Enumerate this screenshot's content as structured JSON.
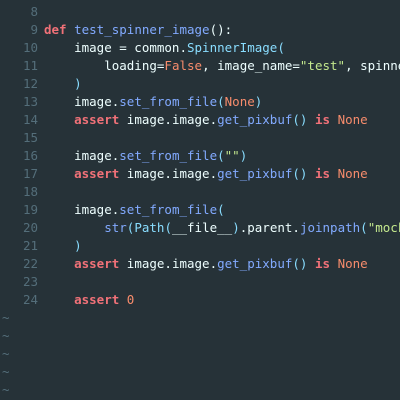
{
  "editor": {
    "colors": {
      "background": "#263238",
      "gutter": "#546e7a",
      "keyword": "#f07178",
      "function": "#82aaff",
      "class": "#89ddff",
      "constant": "#f78c6c",
      "string": "#c3e88d",
      "text": "#eeffff"
    },
    "lines": [
      {
        "num": "8",
        "tokens": []
      },
      {
        "num": "9",
        "tokens": [
          {
            "t": "kw",
            "v": "def"
          },
          {
            "t": "plain",
            "v": " "
          },
          {
            "t": "fn",
            "v": "test_spinner_image"
          },
          {
            "t": "plain",
            "v": "():"
          }
        ]
      },
      {
        "num": "10",
        "tokens": [
          {
            "t": "plain",
            "v": "    image = common."
          },
          {
            "t": "cls",
            "v": "SpinnerImage"
          },
          {
            "t": "punc",
            "v": "("
          }
        ]
      },
      {
        "num": "11",
        "tokens": [
          {
            "t": "plain",
            "v": "        loading="
          },
          {
            "t": "const",
            "v": "False"
          },
          {
            "t": "plain",
            "v": ", image_name="
          },
          {
            "t": "str",
            "v": "\"test\""
          },
          {
            "t": "plain",
            "v": ", spinner_n"
          }
        ]
      },
      {
        "num": "12",
        "tokens": [
          {
            "t": "plain",
            "v": "    "
          },
          {
            "t": "punc",
            "v": ")"
          }
        ]
      },
      {
        "num": "13",
        "tokens": [
          {
            "t": "plain",
            "v": "    image."
          },
          {
            "t": "fn",
            "v": "set_from_file"
          },
          {
            "t": "punc",
            "v": "("
          },
          {
            "t": "const",
            "v": "None"
          },
          {
            "t": "punc",
            "v": ")"
          }
        ]
      },
      {
        "num": "14",
        "tokens": [
          {
            "t": "plain",
            "v": "    "
          },
          {
            "t": "kw",
            "v": "assert"
          },
          {
            "t": "plain",
            "v": " image.image."
          },
          {
            "t": "fn",
            "v": "get_pixbuf"
          },
          {
            "t": "punc",
            "v": "()"
          },
          {
            "t": "plain",
            "v": " "
          },
          {
            "t": "kw",
            "v": "is"
          },
          {
            "t": "plain",
            "v": " "
          },
          {
            "t": "const",
            "v": "None"
          }
        ]
      },
      {
        "num": "15",
        "tokens": []
      },
      {
        "num": "16",
        "tokens": [
          {
            "t": "plain",
            "v": "    image."
          },
          {
            "t": "fn",
            "v": "set_from_file"
          },
          {
            "t": "punc",
            "v": "("
          },
          {
            "t": "str",
            "v": "\"\""
          },
          {
            "t": "punc",
            "v": ")"
          }
        ]
      },
      {
        "num": "17",
        "tokens": [
          {
            "t": "plain",
            "v": "    "
          },
          {
            "t": "kw",
            "v": "assert"
          },
          {
            "t": "plain",
            "v": " image.image."
          },
          {
            "t": "fn",
            "v": "get_pixbuf"
          },
          {
            "t": "punc",
            "v": "()"
          },
          {
            "t": "plain",
            "v": " "
          },
          {
            "t": "kw",
            "v": "is"
          },
          {
            "t": "plain",
            "v": " "
          },
          {
            "t": "const",
            "v": "None"
          }
        ]
      },
      {
        "num": "18",
        "tokens": []
      },
      {
        "num": "19",
        "tokens": [
          {
            "t": "plain",
            "v": "    image."
          },
          {
            "t": "fn",
            "v": "set_from_file"
          },
          {
            "t": "punc",
            "v": "("
          }
        ]
      },
      {
        "num": "20",
        "tokens": [
          {
            "t": "plain",
            "v": "        "
          },
          {
            "t": "fn",
            "v": "str"
          },
          {
            "t": "punc",
            "v": "("
          },
          {
            "t": "cls",
            "v": "Path"
          },
          {
            "t": "punc",
            "v": "("
          },
          {
            "t": "plain",
            "v": "__file__"
          },
          {
            "t": "punc",
            "v": ")"
          },
          {
            "t": "plain",
            "v": ".parent."
          },
          {
            "t": "fn",
            "v": "joinpath"
          },
          {
            "t": "punc",
            "v": "("
          },
          {
            "t": "str",
            "v": "\"mock_da"
          }
        ]
      },
      {
        "num": "21",
        "tokens": [
          {
            "t": "plain",
            "v": "    "
          },
          {
            "t": "punc",
            "v": ")"
          }
        ]
      },
      {
        "num": "22",
        "tokens": [
          {
            "t": "plain",
            "v": "    "
          },
          {
            "t": "kw",
            "v": "assert"
          },
          {
            "t": "plain",
            "v": " image.image."
          },
          {
            "t": "fn",
            "v": "get_pixbuf"
          },
          {
            "t": "punc",
            "v": "()"
          },
          {
            "t": "plain",
            "v": " "
          },
          {
            "t": "kw",
            "v": "is"
          },
          {
            "t": "plain",
            "v": " "
          },
          {
            "t": "const",
            "v": "None"
          }
        ]
      },
      {
        "num": "23",
        "tokens": []
      },
      {
        "num": "24",
        "tokens": [
          {
            "t": "plain",
            "v": "    "
          },
          {
            "t": "kw",
            "v": "assert"
          },
          {
            "t": "plain",
            "v": " "
          },
          {
            "t": "const",
            "v": "0"
          }
        ]
      }
    ],
    "empty_marker": "~",
    "empty_marker_count": 5
  }
}
